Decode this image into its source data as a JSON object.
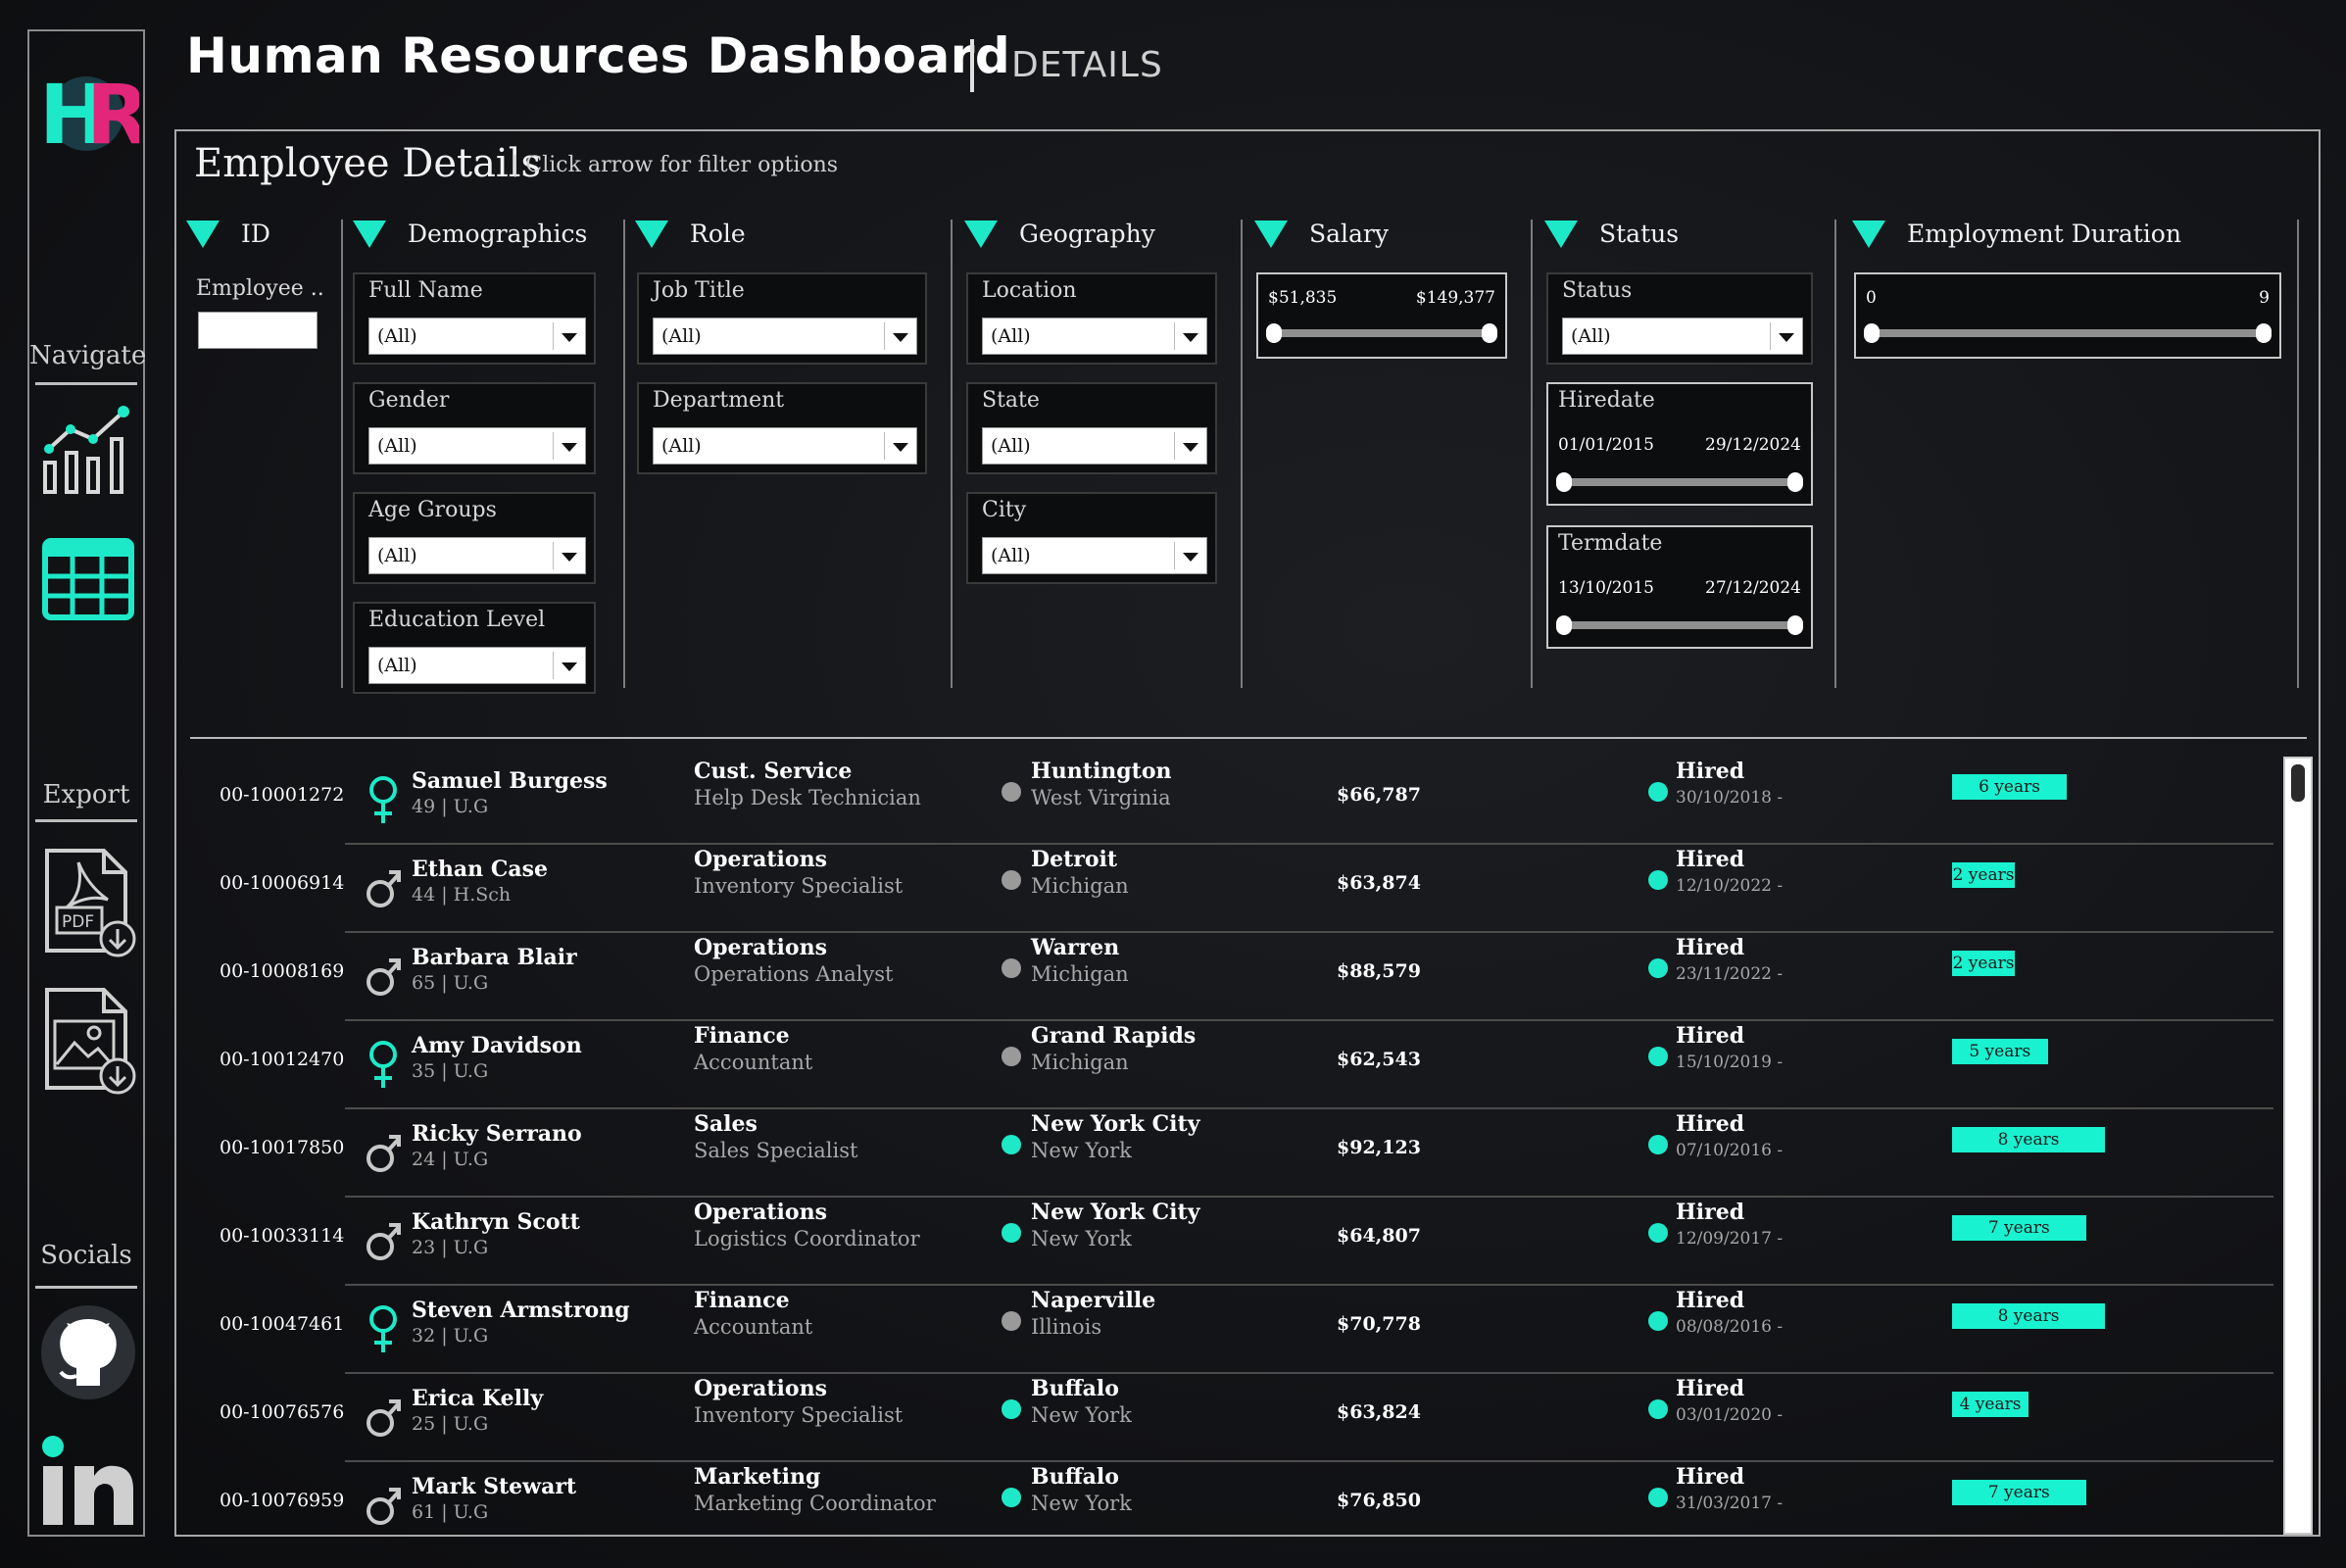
{
  "app": {
    "title": "Human Resources Dashboard",
    "subtitle": "DETAILS",
    "logo_text": "HR"
  },
  "sidebar": {
    "navigate_label": "Navigate",
    "export_label": "Export",
    "socials_label": "Socials",
    "nav_icons": [
      "chart-icon",
      "table-icon"
    ],
    "export_icons": [
      "pdf-download-icon",
      "image-download-icon"
    ],
    "social_icons": [
      "github-icon",
      "linkedin-icon"
    ]
  },
  "panel": {
    "title": "Employee Details",
    "hint": "| Click arrow for filter options"
  },
  "filters": {
    "id": {
      "header": "ID",
      "field_label": "Employee ..",
      "value": ""
    },
    "demographics": {
      "header": "Demographics",
      "full_name": {
        "label": "Full Name",
        "value": "(All)"
      },
      "gender": {
        "label": "Gender",
        "value": "(All)"
      },
      "age_groups": {
        "label": "Age Groups",
        "value": "(All)"
      },
      "education": {
        "label": "Education Level",
        "value": "(All)"
      }
    },
    "role": {
      "header": "Role",
      "job_title": {
        "label": "Job Title",
        "value": "(All)"
      },
      "department": {
        "label": "Department",
        "value": "(All)"
      }
    },
    "geography": {
      "header": "Geography",
      "location": {
        "label": "Location",
        "value": "(All)"
      },
      "state": {
        "label": "State",
        "value": "(All)"
      },
      "city": {
        "label": "City",
        "value": "(All)"
      }
    },
    "salary": {
      "header": "Salary",
      "min": "$51,835",
      "max": "$149,377"
    },
    "status": {
      "header": "Status",
      "status": {
        "label": "Status",
        "value": "(All)"
      },
      "hiredate": {
        "label": "Hiredate",
        "min": "01/01/2015",
        "max": "29/12/2024"
      },
      "termdate": {
        "label": "Termdate",
        "min": "13/10/2015",
        "max": "27/12/2024"
      }
    },
    "duration": {
      "header": "Employment Duration",
      "min": "0",
      "max": "9"
    }
  },
  "colors": {
    "accent": "#1de9c8",
    "location_remote": "#1de9c8",
    "location_hq": "#9a9a9a",
    "bar": "#19f2d0"
  },
  "employees": [
    {
      "id": "00-10001272",
      "gender": "female",
      "name": "Samuel Burgess",
      "meta": "49 | U.G",
      "department": "Cust. Service",
      "job": "Help Desk Technician",
      "loc": "hq",
      "city": "Huntington",
      "state": "West Virginia",
      "salary": "$66,787",
      "status": "Hired",
      "hire": "30/10/2018 -",
      "years": 6,
      "years_label": "6 years"
    },
    {
      "id": "00-10006914",
      "gender": "male",
      "name": "Ethan Case",
      "meta": "44 | H.Sch",
      "department": "Operations",
      "job": "Inventory Specialist",
      "loc": "hq",
      "city": "Detroit",
      "state": "Michigan",
      "salary": "$63,874",
      "status": "Hired",
      "hire": "12/10/2022 -",
      "years": 2,
      "years_label": "2 years"
    },
    {
      "id": "00-10008169",
      "gender": "male",
      "name": "Barbara Blair",
      "meta": "65 | U.G",
      "department": "Operations",
      "job": "Operations Analyst",
      "loc": "hq",
      "city": "Warren",
      "state": "Michigan",
      "salary": "$88,579",
      "status": "Hired",
      "hire": "23/11/2022 -",
      "years": 2,
      "years_label": "2 years"
    },
    {
      "id": "00-10012470",
      "gender": "female",
      "name": "Amy Davidson",
      "meta": "35 | U.G",
      "department": "Finance",
      "job": "Accountant",
      "loc": "hq",
      "city": "Grand Rapids",
      "state": "Michigan",
      "salary": "$62,543",
      "status": "Hired",
      "hire": "15/10/2019 -",
      "years": 5,
      "years_label": "5 years"
    },
    {
      "id": "00-10017850",
      "gender": "male",
      "name": "Ricky Serrano",
      "meta": "24 | U.G",
      "department": "Sales",
      "job": "Sales Specialist",
      "loc": "remote",
      "city": "New York City",
      "state": "New York",
      "salary": "$92,123",
      "status": "Hired",
      "hire": "07/10/2016 -",
      "years": 8,
      "years_label": "8 years"
    },
    {
      "id": "00-10033114",
      "gender": "male",
      "name": "Kathryn Scott",
      "meta": "23 | U.G",
      "department": "Operations",
      "job": "Logistics Coordinator",
      "loc": "remote",
      "city": "New York City",
      "state": "New York",
      "salary": "$64,807",
      "status": "Hired",
      "hire": "12/09/2017 -",
      "years": 7,
      "years_label": "7 years"
    },
    {
      "id": "00-10047461",
      "gender": "female",
      "name": "Steven Armstrong",
      "meta": "32 | U.G",
      "department": "Finance",
      "job": "Accountant",
      "loc": "hq",
      "city": "Naperville",
      "state": "Illinois",
      "salary": "$70,778",
      "status": "Hired",
      "hire": "08/08/2016 -",
      "years": 8,
      "years_label": "8 years"
    },
    {
      "id": "00-10076576",
      "gender": "male",
      "name": "Erica Kelly",
      "meta": "25 | U.G",
      "department": "Operations",
      "job": "Inventory Specialist",
      "loc": "remote",
      "city": "Buffalo",
      "state": "New York",
      "salary": "$63,824",
      "status": "Hired",
      "hire": "03/01/2020 -",
      "years": 4,
      "years_label": "4 years"
    },
    {
      "id": "00-10076959",
      "gender": "male",
      "name": "Mark Stewart",
      "meta": "61 | U.G",
      "department": "Marketing",
      "job": "Marketing Coordinator",
      "loc": "remote",
      "city": "Buffalo",
      "state": "New York",
      "salary": "$76,850",
      "status": "Hired",
      "hire": "31/03/2017 -",
      "years": 7,
      "years_label": "7 years"
    }
  ]
}
